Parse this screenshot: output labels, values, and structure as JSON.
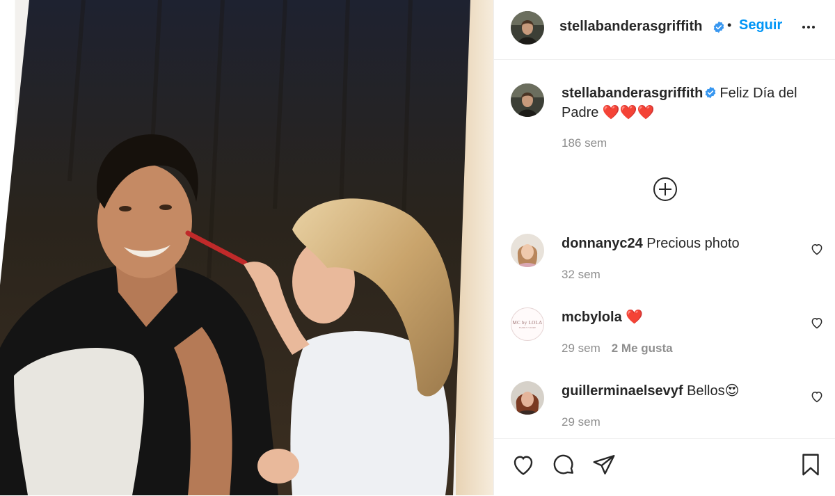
{
  "post": {
    "author": "stellabanderasgriffith",
    "follow_label": "Seguir",
    "separator": "•",
    "caption": {
      "username": "stellabanderasgriffith",
      "text": "Feliz Día del Padre ❤️❤️❤️",
      "time": "186 sem"
    }
  },
  "comments": [
    {
      "username": "donnanyc24",
      "text": "Precious photo",
      "time": "32 sem",
      "likes": ""
    },
    {
      "username": "mcbylola",
      "text": "❤️",
      "time": "29 sem",
      "likes": "2 Me gusta",
      "avatar_logo": "MC by LOLA",
      "avatar_logo_sub": "FAMILY STORE"
    },
    {
      "username": "guillerminaelsevyf",
      "text": "Bellos😍",
      "time": "29 sem",
      "likes": ""
    }
  ],
  "icons": {
    "verified": "verified-badge-icon",
    "more": "more-options-icon",
    "load_more": "plus-circle-icon",
    "like": "heart-icon",
    "comment": "comment-icon",
    "share": "paper-plane-icon",
    "save": "bookmark-icon"
  },
  "colors": {
    "accent": "#0095f6",
    "text": "#262626",
    "secondary": "#8e8e8e",
    "verified": "#3897f0"
  }
}
